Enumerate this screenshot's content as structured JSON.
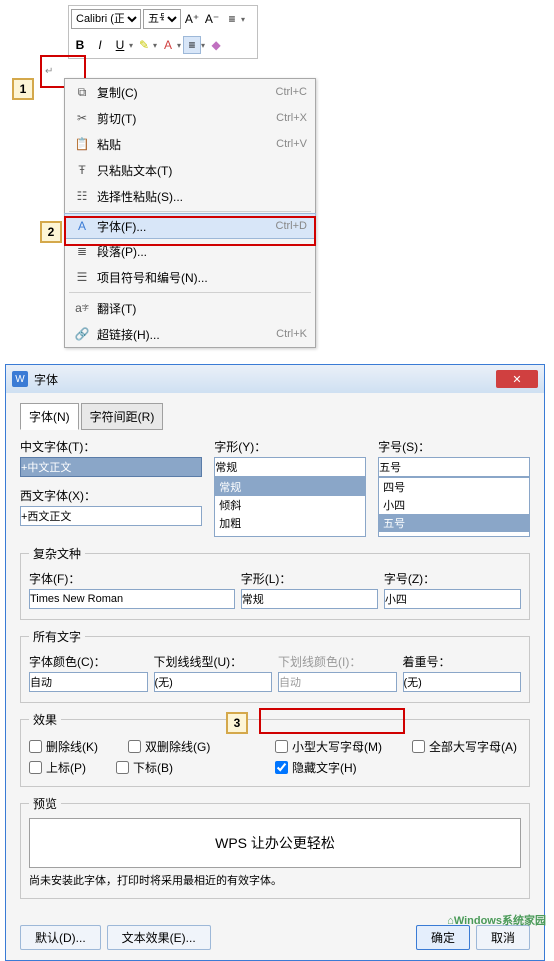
{
  "toolbar": {
    "font": "Calibri (正",
    "size": "五号",
    "bold": "B",
    "italic": "I",
    "underline": "U"
  },
  "callouts": {
    "c1": "1",
    "c2": "2",
    "c3": "3"
  },
  "menu": {
    "copy": {
      "label": "复制(C)",
      "shortcut": "Ctrl+C"
    },
    "cut": {
      "label": "剪切(T)",
      "shortcut": "Ctrl+X"
    },
    "paste": {
      "label": "粘贴",
      "shortcut": "Ctrl+V"
    },
    "paste_text": {
      "label": "只粘贴文本(T)"
    },
    "paste_special": {
      "label": "选择性粘贴(S)..."
    },
    "font": {
      "label": "字体(F)...",
      "shortcut": "Ctrl+D"
    },
    "paragraph": {
      "label": "段落(P)..."
    },
    "bullets": {
      "label": "项目符号和编号(N)..."
    },
    "translate": {
      "label": "翻译(T)"
    },
    "hyperlink": {
      "label": "超链接(H)...",
      "shortcut": "Ctrl+K"
    }
  },
  "dlg": {
    "title": "字体",
    "tab1": "字体(N)",
    "tab2": "字符间距(R)",
    "cn_font_label": "中文字体(T)：",
    "cn_font": "+中文正文",
    "west_font_label": "西文字体(X)：",
    "west_font": "+西文正文",
    "style_label": "字形(Y)：",
    "style_value": "常规",
    "styles": [
      "常规",
      "倾斜",
      "加粗"
    ],
    "size_label": "字号(S)：",
    "size_value": "五号",
    "sizes": [
      "四号",
      "小四",
      "五号"
    ],
    "complex_legend": "复杂文种",
    "cx_font_label": "字体(F)：",
    "cx_font": "Times New Roman",
    "cx_style_label": "字形(L)：",
    "cx_style": "常规",
    "cx_size_label": "字号(Z)：",
    "cx_size": "小四",
    "alltext_legend": "所有文字",
    "font_color_label": "字体颜色(C)：",
    "font_color": "自动",
    "under_style_label": "下划线线型(U)：",
    "under_style": "(无)",
    "under_color_label": "下划线颜色(I)：",
    "under_color": "自动",
    "emphasis_label": "着重号：",
    "emphasis": "(无)",
    "effects_legend": "效果",
    "eff": {
      "strike": "删除线(K)",
      "dstrike": "双删除线(G)",
      "super": "上标(P)",
      "sub": "下标(B)",
      "smallcaps": "小型大写字母(M)",
      "allcaps": "全部大写字母(A)",
      "hidden": "隐藏文字(H)"
    },
    "preview_legend": "预览",
    "preview_text": "WPS 让办公更轻松",
    "hint": "尚未安装此字体，打印时将采用最相近的有效字体。",
    "def_btn": "默认(D)...",
    "texteff_btn": "文本效果(E)...",
    "ok": "确定",
    "cancel": "取消"
  },
  "watermark": "Windows系统家园"
}
